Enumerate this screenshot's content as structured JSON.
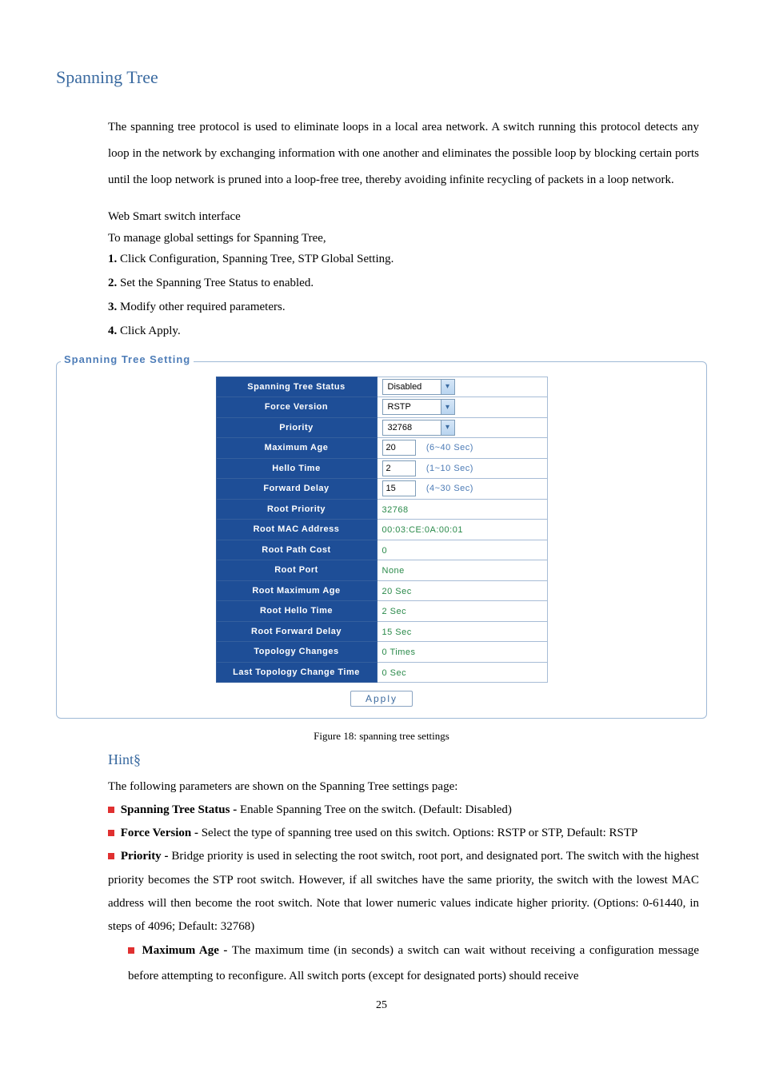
{
  "title": "Spanning Tree",
  "intro": "The spanning tree protocol is used to eliminate loops in a local area network. A switch running this protocol detects any loop in the network by exchanging information with one another and eliminates the possible loop by blocking certain ports until the loop network is pruned into a loop-free tree, thereby avoiding infinite recycling of packets in a loop network.",
  "iface_heading": "Web Smart switch interface",
  "iface_sub": "To manage global settings for Spanning Tree,",
  "steps": {
    "s1n": "1.",
    "s1": " Click Configuration, Spanning Tree, STP Global Setting.",
    "s2n": "2.",
    "s2": " Set the Spanning Tree Status to enabled.",
    "s3n": "3.",
    "s3": " Modify other required parameters.",
    "s4n": "4.",
    "s4": " Click Apply."
  },
  "panel_title": "Spanning Tree Setting",
  "rows": {
    "status_lbl": "Spanning Tree Status",
    "status_val": "Disabled",
    "version_lbl": "Force Version",
    "version_val": "RSTP",
    "priority_lbl": "Priority",
    "priority_val": "32768",
    "maxage_lbl": "Maximum Age",
    "maxage_val": "20",
    "maxage_hint": "(6~40 Sec)",
    "hello_lbl": "Hello Time",
    "hello_val": "2",
    "hello_hint": "(1~10 Sec)",
    "fwd_lbl": "Forward Delay",
    "fwd_val": "15",
    "fwd_hint": "(4~30 Sec)",
    "rootpri_lbl": "Root Priority",
    "rootpri_val": "32768",
    "rootmac_lbl": "Root MAC Address",
    "rootmac_val": "00:03:CE:0A:00:01",
    "rootcost_lbl": "Root Path Cost",
    "rootcost_val": "0",
    "rootport_lbl": "Root Port",
    "rootport_val": "None",
    "rootmax_lbl": "Root Maximum Age",
    "rootmax_val": "20 Sec",
    "roothello_lbl": "Root Hello Time",
    "roothello_val": "2 Sec",
    "rootfwd_lbl": "Root Forward Delay",
    "rootfwd_val": "15 Sec",
    "topo_lbl": "Topology Changes",
    "topo_val": "0 Times",
    "last_lbl": "Last Topology Change Time",
    "last_val": "0 Sec"
  },
  "apply": "Apply",
  "caption": "Figure 18: spanning tree settings",
  "hint_title": "Hint§",
  "hint_intro": "The following parameters are shown on the Spanning Tree settings page:",
  "hints": {
    "h1b": "Spanning Tree Status - ",
    "h1": "Enable Spanning Tree on the switch. (Default: Disabled)",
    "h2b": "Force Version - ",
    "h2": "Select the type of spanning tree used on this switch. Options: RSTP or STP, Default: RSTP",
    "h3b": "Priority - ",
    "h3": "Bridge priority is used in selecting the root switch, root port, and designated port. The switch with the highest priority becomes the STP root switch. However, if all switches have the same priority, the switch with the lowest MAC address will then become the root switch. Note that lower numeric values indicate higher priority. (Options: 0-61440, in steps of 4096; Default: 32768)",
    "h4b": "Maximum Age - ",
    "h4": "The maximum time (in seconds) a switch can wait without receiving a configuration message before attempting to reconfigure. All switch ports (except for designated ports) should receive"
  },
  "page": "25"
}
